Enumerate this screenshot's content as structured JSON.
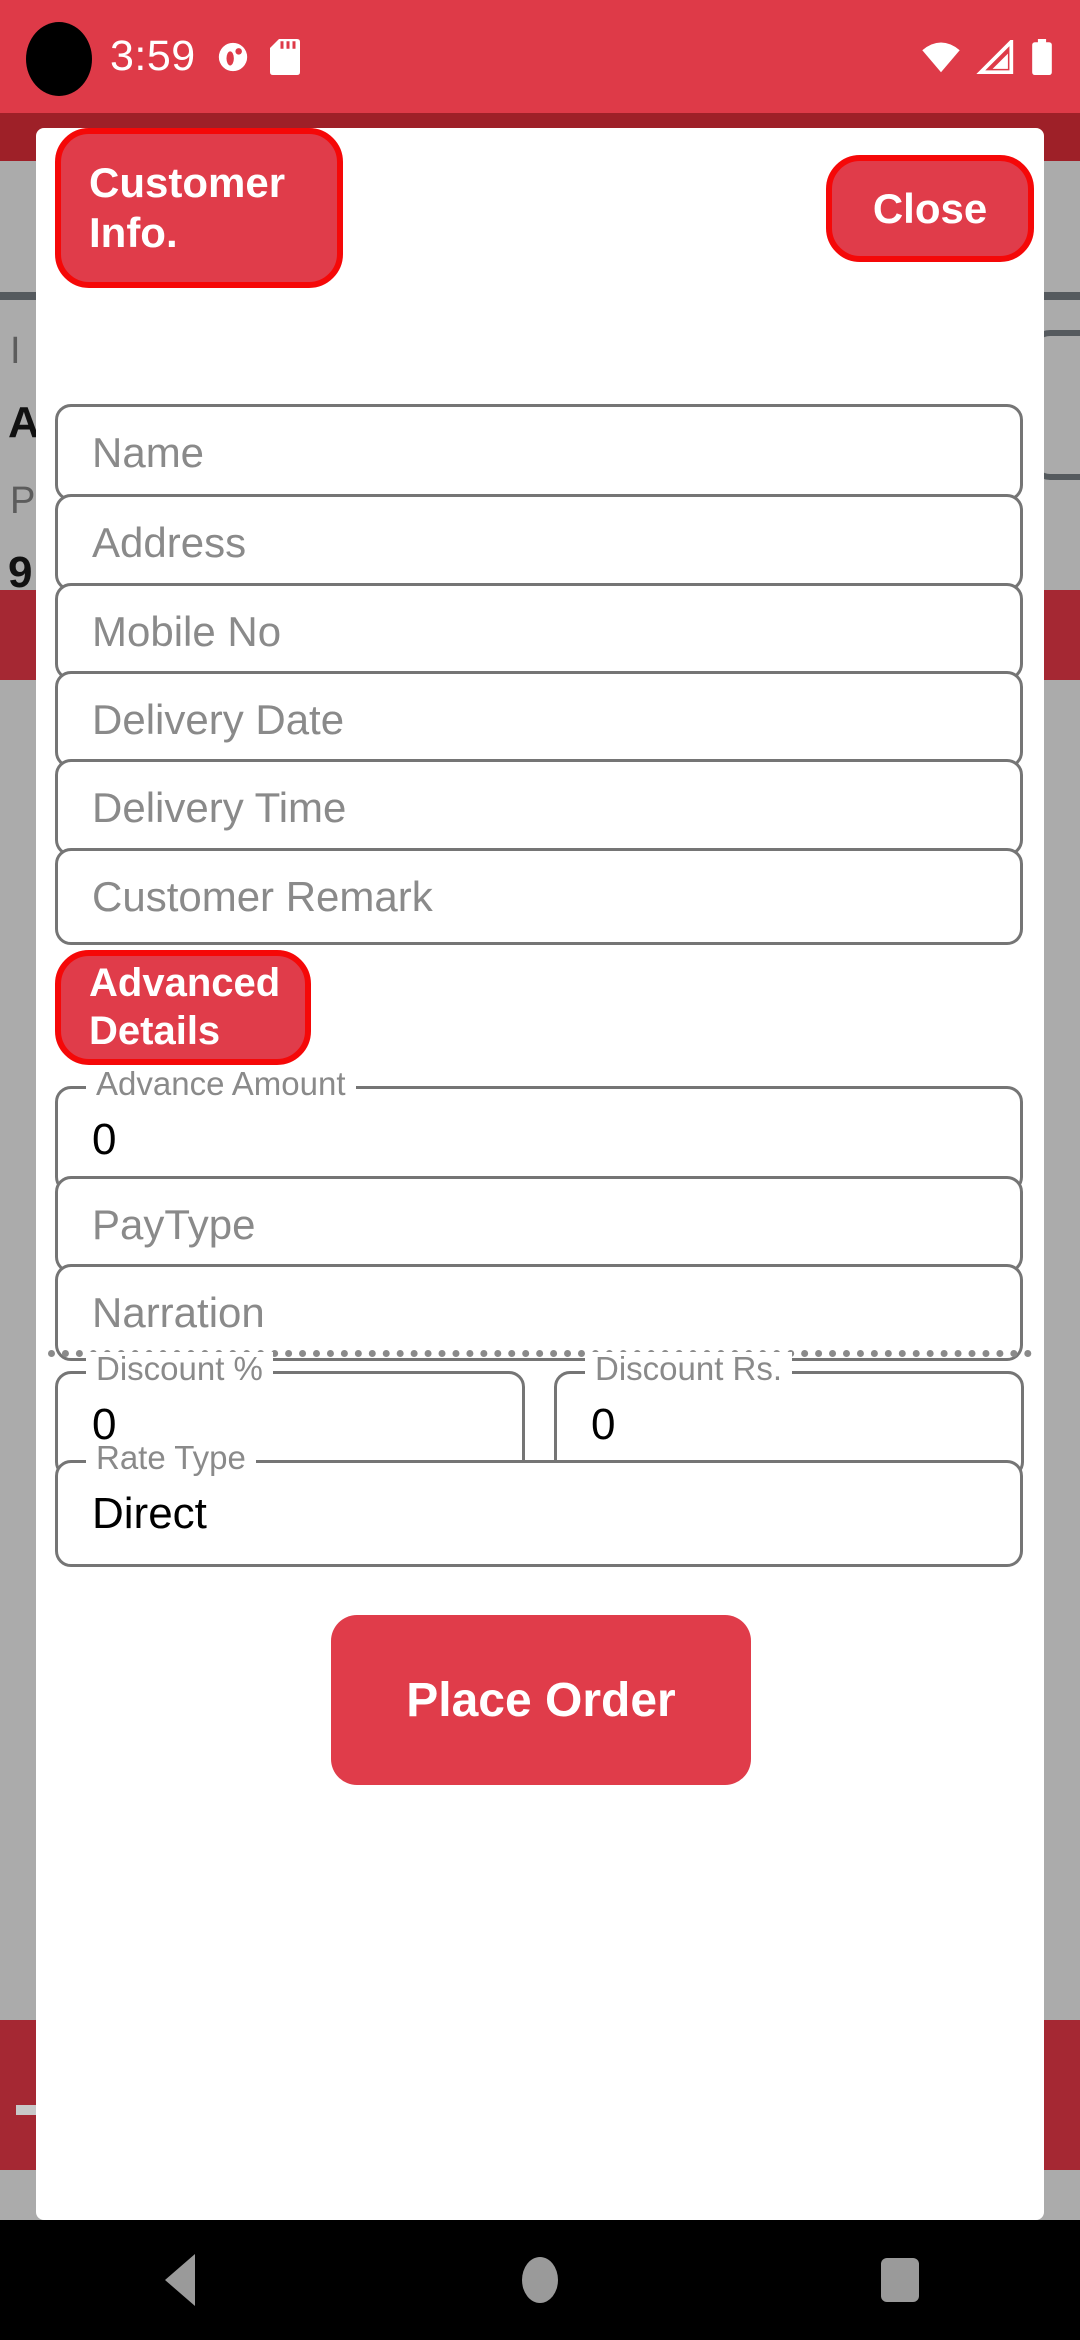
{
  "status_bar": {
    "time": "3:59",
    "icons_left": [
      "app-notification-icon",
      "sd-card-icon"
    ],
    "icons_right": [
      "wifi-icon",
      "cellular-signal-icon",
      "battery-icon"
    ],
    "background_color": "#DE3A48"
  },
  "dialog": {
    "title_button": "Customer Info.",
    "close_button": "Close",
    "section_button": "Advanced Details",
    "submit_button": "Place Order",
    "accent_color": "#E03C4A",
    "highlight_ring_color": "#F50808"
  },
  "fields": [
    {
      "name": "name",
      "placeholder": "Name",
      "value": ""
    },
    {
      "name": "address",
      "placeholder": "Address",
      "value": ""
    },
    {
      "name": "mobile-no",
      "placeholder": "Mobile No",
      "value": ""
    },
    {
      "name": "delivery-date",
      "placeholder": "Delivery Date",
      "value": ""
    },
    {
      "name": "delivery-time",
      "placeholder": "Delivery Time",
      "value": ""
    },
    {
      "name": "customer-remark",
      "placeholder": "Customer Remark",
      "value": ""
    }
  ],
  "advanced": [
    {
      "name": "advance-amount",
      "label": "Advance Amount",
      "value": "0"
    },
    {
      "name": "pay-type",
      "label": "",
      "placeholder": "PayType",
      "value": ""
    },
    {
      "name": "narration",
      "label": "",
      "placeholder": "Narration",
      "value": ""
    }
  ],
  "discount": {
    "percent": {
      "label": "Discount %",
      "value": "0"
    },
    "rupees": {
      "label": "Discount Rs.",
      "value": "0"
    }
  },
  "rate_type": {
    "label": "Rate Type",
    "value": "Direct"
  },
  "background": {
    "text_line_1": "I",
    "text_line_2": "A",
    "text_line_3": "P",
    "text_line_4": "9"
  },
  "nav_bar": {
    "back": "back-icon",
    "home": "home-icon",
    "recents": "recents-icon"
  }
}
